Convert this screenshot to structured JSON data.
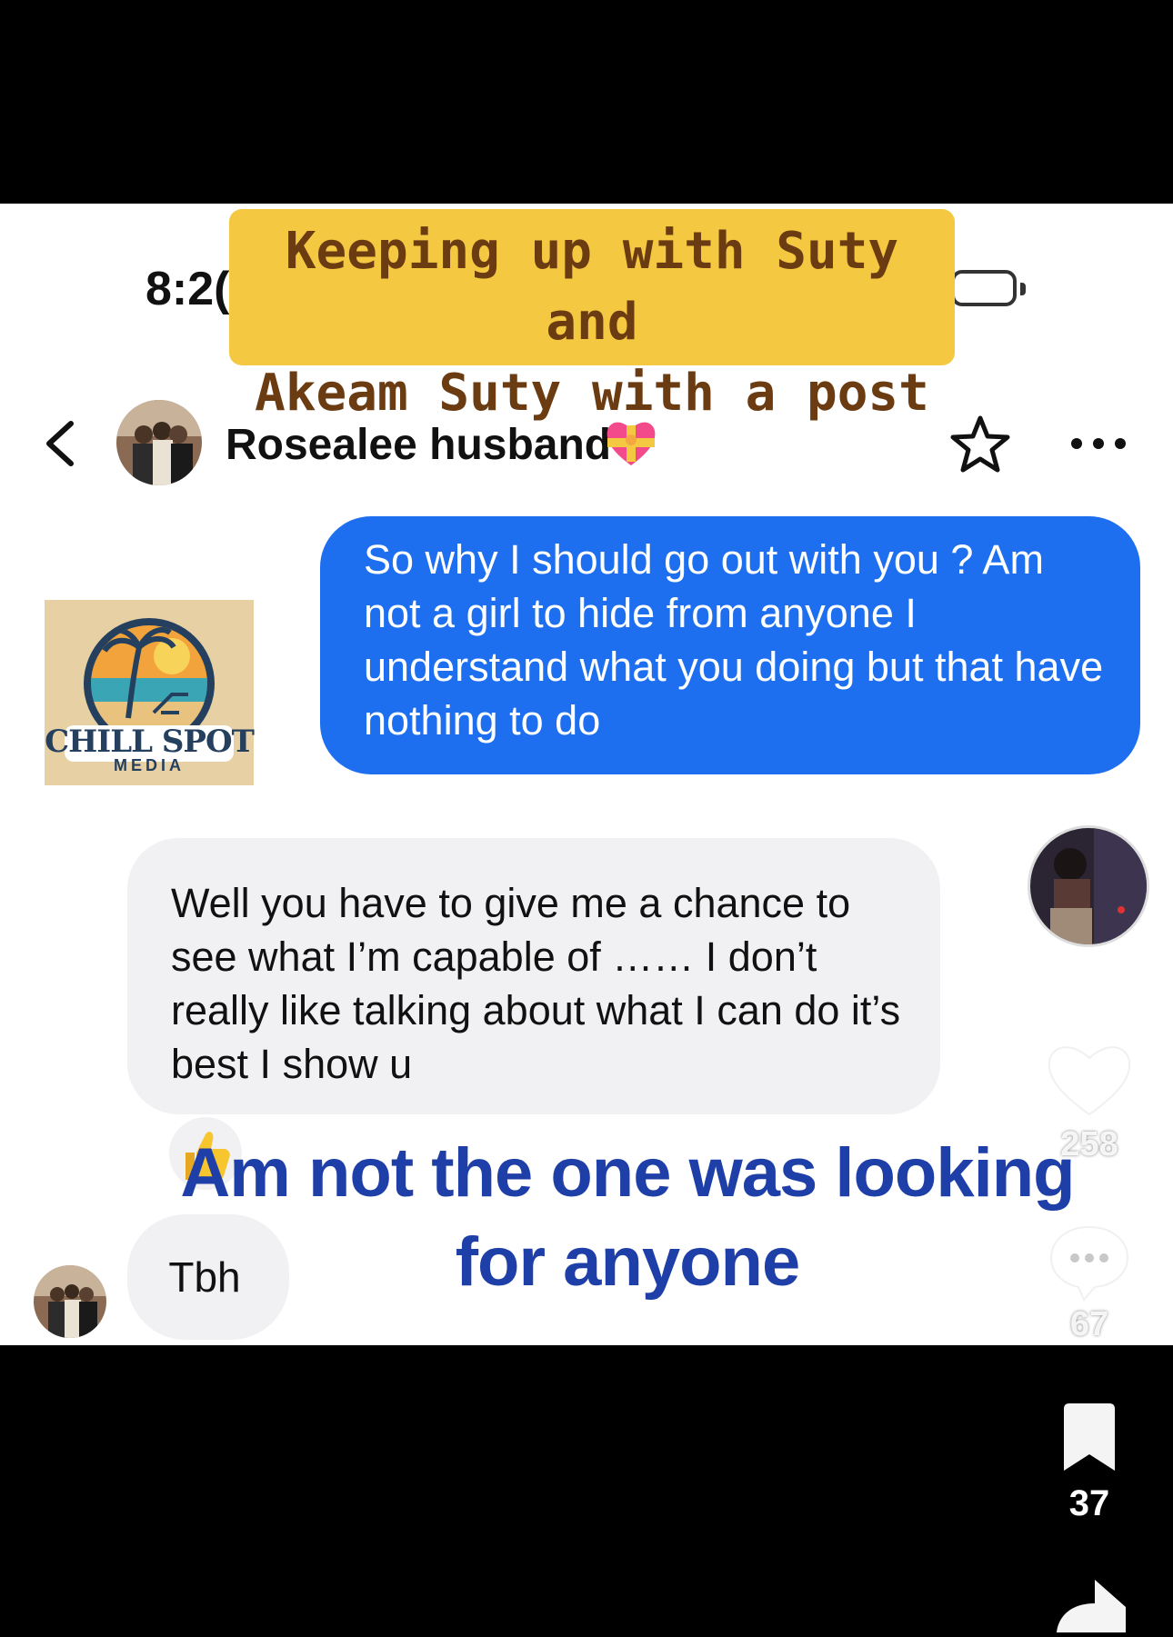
{
  "status_bar": {
    "time": "8:2("
  },
  "caption": {
    "line1": "Keeping up with Suty and",
    "line2": "Akeam Suty with a post"
  },
  "header": {
    "contact_name": "Rosealee husband",
    "emoji_icon": "heart-with-ribbon-icon",
    "star_icon": "star-icon",
    "more_icon": "more-dots-icon"
  },
  "watermark": {
    "line1": "CHILL SPOT",
    "line2": "MEDIA"
  },
  "messages": [
    {
      "side": "sent",
      "text": "So why I should go out with you ? Am not a girl to hide from anyone I understand what you doing but that have nothing to do"
    },
    {
      "side": "received",
      "text": "Well you have to give me a chance to see what I’m capable of …… I don’t really like talking about what I can do it’s best I show u"
    },
    {
      "side": "received",
      "text": "Tbh"
    }
  ],
  "overlay": {
    "line1": "Am not the one was looking",
    "line2": "for anyone"
  },
  "actions": {
    "likes": "258",
    "comments": "67",
    "saves": "37"
  },
  "colors": {
    "sent_bubble": "#1d6ff0",
    "received_bubble": "#f1f1f3",
    "caption_bg": "#f5c842",
    "overlay_text": "#1f3fa8"
  }
}
